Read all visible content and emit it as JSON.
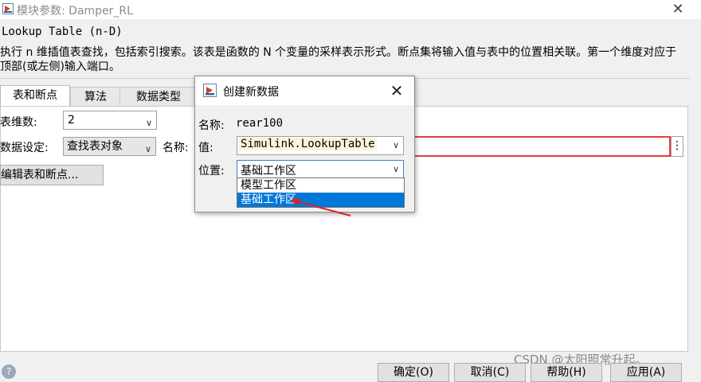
{
  "window": {
    "title": "模块参数: Damper_RL",
    "close_glyph": "✕",
    "block_type": "Lookup Table (n-D)",
    "description": "执行 n 维插值表查找，包括索引搜索。该表是函数的 N 个变量的采样表示形式。断点集将输入值与表中的位置相关联。第一个维度对应于顶部(或左侧)输入端口。"
  },
  "tabs": [
    {
      "label": "表和断点"
    },
    {
      "label": "算法"
    },
    {
      "label": "数据类型"
    }
  ],
  "form": {
    "dims_label": "表维数:",
    "dims_value": "2",
    "data_spec_label": "数据设定:",
    "data_spec_value": "查找表对象",
    "name_label": "名称:",
    "more_glyph": "⋮",
    "edit_button": "编辑表和断点..."
  },
  "footer": {
    "ok": "确定(O)",
    "cancel": "取消(C)",
    "help": "帮助(H)",
    "apply": "应用(A)",
    "help_icon": "?"
  },
  "watermark": "CSDN @太阳照常升起。",
  "dialog": {
    "title": "创建新数据",
    "close_glyph": "✕",
    "name_label": "名称:",
    "name_value": "rear100",
    "value_label": "值:",
    "value_selected": "Simulink.LookupTable",
    "location_label": "位置:",
    "location_selected": "基础工作区",
    "location_options": [
      "模型工作区",
      "基础工作区"
    ],
    "highlighted_option": 1
  },
  "colors": {
    "selection": "#0078d7",
    "error_border": "#e04040",
    "annotation_arrow": "#e02020"
  }
}
